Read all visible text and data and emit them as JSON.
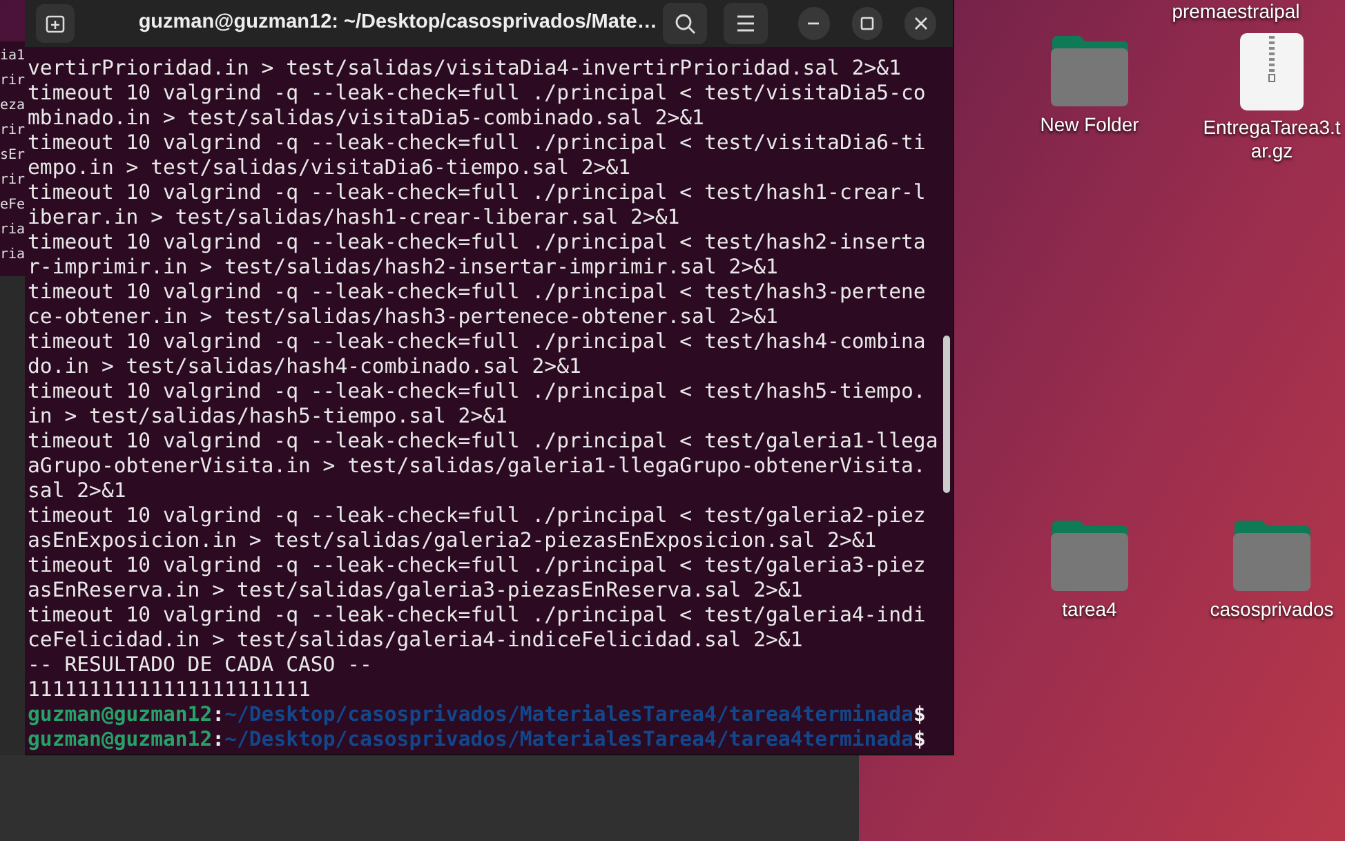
{
  "background_window": {
    "fragments": [
      "ia1",
      "rir",
      "eza",
      "rir",
      "sEr",
      "rir",
      "eFe",
      "ria",
      "ria"
    ]
  },
  "terminal": {
    "title": "guzman@guzman12: ~/Desktop/casosprivados/Mate…",
    "lines": [
      {
        "kind": "text",
        "text": "vertirPrioridad.in > test/salidas/visitaDia4-invertirPrioridad.sal 2>&1"
      },
      {
        "kind": "text",
        "text": "timeout 10 valgrind -q --leak-check=full ./principal < test/visitaDia5-co"
      },
      {
        "kind": "text",
        "text": "mbinado.in > test/salidas/visitaDia5-combinado.sal 2>&1"
      },
      {
        "kind": "text",
        "text": "timeout 10 valgrind -q --leak-check=full ./principal < test/visitaDia6-ti"
      },
      {
        "kind": "text",
        "text": "empo.in > test/salidas/visitaDia6-tiempo.sal 2>&1"
      },
      {
        "kind": "text",
        "text": "timeout 10 valgrind -q --leak-check=full ./principal < test/hash1-crear-l"
      },
      {
        "kind": "text",
        "text": "iberar.in > test/salidas/hash1-crear-liberar.sal 2>&1"
      },
      {
        "kind": "text",
        "text": "timeout 10 valgrind -q --leak-check=full ./principal < test/hash2-inserta"
      },
      {
        "kind": "text",
        "text": "r-imprimir.in > test/salidas/hash2-insertar-imprimir.sal 2>&1"
      },
      {
        "kind": "text",
        "text": "timeout 10 valgrind -q --leak-check=full ./principal < test/hash3-pertene"
      },
      {
        "kind": "text",
        "text": "ce-obtener.in > test/salidas/hash3-pertenece-obtener.sal 2>&1"
      },
      {
        "kind": "text",
        "text": "timeout 10 valgrind -q --leak-check=full ./principal < test/hash4-combina"
      },
      {
        "kind": "text",
        "text": "do.in > test/salidas/hash4-combinado.sal 2>&1"
      },
      {
        "kind": "text",
        "text": "timeout 10 valgrind -q --leak-check=full ./principal < test/hash5-tiempo."
      },
      {
        "kind": "text",
        "text": "in > test/salidas/hash5-tiempo.sal 2>&1"
      },
      {
        "kind": "text",
        "text": "timeout 10 valgrind -q --leak-check=full ./principal < test/galeria1-llega"
      },
      {
        "kind": "text",
        "text": "aGrupo-obtenerVisita.in > test/salidas/galeria1-llegaGrupo-obtenerVisita."
      },
      {
        "kind": "text",
        "text": "sal 2>&1"
      },
      {
        "kind": "text",
        "text": "timeout 10 valgrind -q --leak-check=full ./principal < test/galeria2-piez"
      },
      {
        "kind": "text",
        "text": "asEnExposicion.in > test/salidas/galeria2-piezasEnExposicion.sal 2>&1"
      },
      {
        "kind": "text",
        "text": "timeout 10 valgrind -q --leak-check=full ./principal < test/galeria3-piez"
      },
      {
        "kind": "text",
        "text": "asEnReserva.in > test/salidas/galeria3-piezasEnReserva.sal 2>&1"
      },
      {
        "kind": "text",
        "text": "timeout 10 valgrind -q --leak-check=full ./principal < test/galeria4-indi"
      },
      {
        "kind": "text",
        "text": "ceFelicidad.in > test/salidas/galeria4-indiceFelicidad.sal 2>&1"
      },
      {
        "kind": "text",
        "text": "-- RESULTADO DE CADA CASO --"
      },
      {
        "kind": "text",
        "text": "11111111111111111111111"
      },
      {
        "kind": "prompt",
        "user": "guzman@guzman12",
        "sep": ":",
        "path": "~/Desktop/casosprivados/MaterialesTarea4/tarea4terminada",
        "symbol": "$"
      },
      {
        "kind": "prompt",
        "user": "guzman@guzman12",
        "sep": ":",
        "path": "~/Desktop/casosprivados/MaterialesTarea4/tarea4terminada",
        "symbol": "$"
      }
    ]
  },
  "desktop_icons": [
    {
      "kind": "partial",
      "label": "premaestraipal"
    },
    {
      "kind": "folder",
      "label": "New Folder"
    },
    {
      "kind": "archive",
      "label": "EntregaTarea3.tar.gz"
    },
    {
      "kind": "folder",
      "label": "tarea4"
    },
    {
      "kind": "folder",
      "label": "casosprivados"
    }
  ]
}
